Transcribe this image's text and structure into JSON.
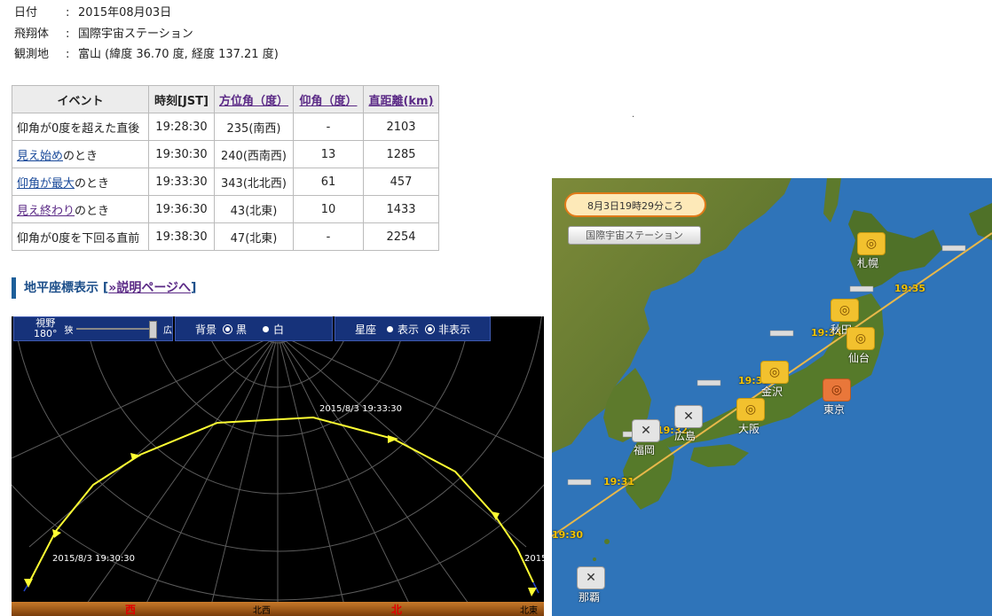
{
  "info": {
    "date_label": "日付",
    "date_value": "2015年08月03日",
    "craft_label": "飛翔体",
    "craft_value": "国際宇宙ステーション",
    "site_label": "観測地",
    "site_value": "富山 (緯度 36.70 度, 経度 137.21 度)",
    "colon": ":"
  },
  "stray_dot": ".",
  "table": {
    "headers": [
      "イベント",
      "時刻[JST]",
      "方位角（度）",
      "仰角（度）",
      "直距離(km)"
    ],
    "rows": [
      {
        "event_link": "",
        "event_text": "仰角が0度を超えた直後",
        "time": "19:28:30",
        "az": "235(南西)",
        "el": "-",
        "dist": "2103"
      },
      {
        "event_link": "見え始め",
        "event_text": "のとき",
        "time": "19:30:30",
        "az": "240(西南西)",
        "el": "13",
        "dist": "1285"
      },
      {
        "event_link": "仰角が最大",
        "event_text": "のとき",
        "time": "19:33:30",
        "az": "343(北北西)",
        "el": "61",
        "dist": "457"
      },
      {
        "event_link": "見え終わり",
        "event_text": "のとき",
        "time": "19:36:30",
        "az": "43(北東)",
        "el": "10",
        "dist": "1433"
      },
      {
        "event_link": "",
        "event_text": "仰角が0度を下回る直前",
        "time": "19:38:30",
        "az": "47(北東)",
        "el": "-",
        "dist": "2254"
      }
    ]
  },
  "section": {
    "title": "地平座標表示",
    "bracket_open": "[",
    "link": "»説明ページへ",
    "bracket_close": "]"
  },
  "sky": {
    "fov_label": "視野",
    "fov_value": "180°",
    "zoom_min": "狭",
    "zoom_max": "広",
    "bg_label": "背景",
    "bg_black": "黒",
    "bg_white": "白",
    "const_label": "星座",
    "const_show": "表示",
    "const_hide": "非表示",
    "label_start": "2015/8/3 19:30:30",
    "label_max": "2015/8/3 19:33:30",
    "label_end": "2015",
    "dir_west": "西",
    "dir_nw": "北西",
    "dir_north": "北",
    "dir_ne": "北東",
    "track_color": "#ffff33",
    "bg_color": "#000000"
  },
  "map": {
    "bubble": "8月3日19時29分ころ",
    "sat_button": "国際宇宙ステーション",
    "cities": {
      "sapporo": "札幌",
      "akita": "秋田",
      "sendai": "仙台",
      "kanazawa": "金沢",
      "tokyo": "東京",
      "osaka": "大阪",
      "hiroshima": "広島",
      "fukuoka": "福岡",
      "naha": "那覇"
    },
    "city_mark_visible": "◎",
    "city_mark_none": "✕",
    "times": [
      "19:35",
      "19:34",
      "19:33",
      "19:32",
      "19:31",
      "19:30"
    ],
    "track_color": "#e8b84a",
    "sea_color": "#2f74b9"
  }
}
